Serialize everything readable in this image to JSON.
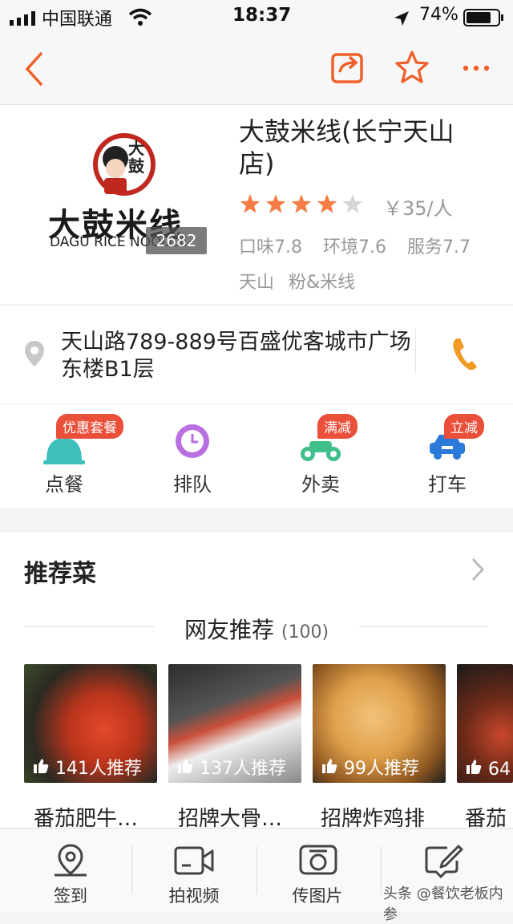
{
  "status": {
    "carrier": "中国联通",
    "time": "18:37",
    "battery": "74%"
  },
  "shop": {
    "logo_cn": "大鼓米线",
    "logo_en": "DAGU RICE NOODLE",
    "logo_mascot": "大鼓",
    "photo_count": "2682",
    "name": "大鼓米线(长宁天山店)",
    "rating": 4,
    "price": "￥35/人",
    "scores": [
      "口味7.8",
      "环境7.6",
      "服务7.7"
    ],
    "tags": [
      "天山",
      "粉&米线"
    ],
    "address": "天山路789-889号百盛优客城市广场东楼B1层"
  },
  "functions": [
    {
      "label": "点餐",
      "badge": "优惠套餐",
      "icon": "dish-cover-icon"
    },
    {
      "label": "排队",
      "badge": "",
      "icon": "clock-icon"
    },
    {
      "label": "外卖",
      "badge": "满减",
      "icon": "scooter-icon"
    },
    {
      "label": "打车",
      "badge": "立减",
      "icon": "car-icon"
    }
  ],
  "recommend": {
    "title": "推荐菜",
    "friends_label": "网友推荐",
    "friends_count": "(100)",
    "dishes": [
      {
        "name": "番茄肥牛…",
        "likes": "141人推荐"
      },
      {
        "name": "招牌大骨…",
        "likes": "137人推荐"
      },
      {
        "name": "招牌炸鸡排",
        "likes": "99人推荐"
      },
      {
        "name": "番茄",
        "likes": "64"
      }
    ]
  },
  "tabbar": [
    {
      "label": "签到",
      "icon": "location-pin-icon"
    },
    {
      "label": "拍视频",
      "icon": "video-camera-icon"
    },
    {
      "label": "传图片",
      "icon": "photo-camera-icon"
    },
    {
      "label": "写点评",
      "icon": "edit-icon"
    }
  ],
  "watermark": "头条 @餐饮老板内参",
  "colors": {
    "accent": "#f0602a",
    "star": "#f47c45",
    "badge": "#ea4f3a",
    "purple": "#b96fe0",
    "green": "#3fbf8a",
    "blue": "#2b79d8"
  }
}
